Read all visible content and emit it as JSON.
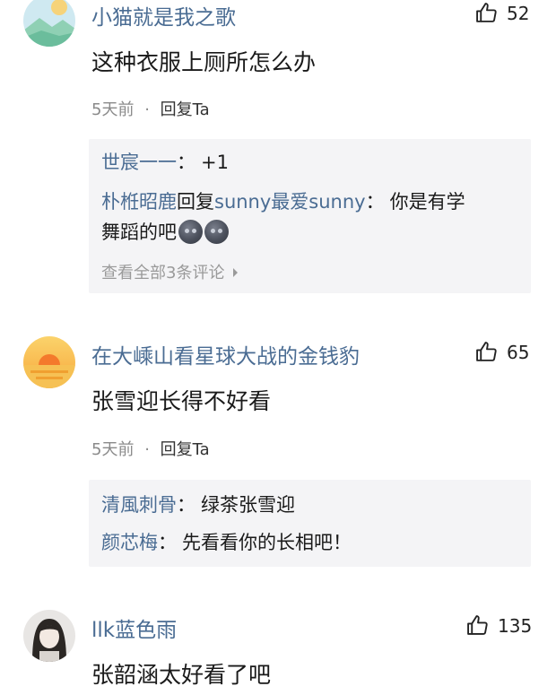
{
  "comments": [
    {
      "username": "小猫就是我之歌",
      "likes": "52",
      "text": "这种衣服上厕所怎么办",
      "time": "5天前",
      "dot": "·",
      "reply_label": "回复Ta",
      "replies": [
        {
          "name": "世宸一一",
          "sep": "：",
          "content": "+1"
        },
        {
          "name": "朴栣昭鹿",
          "middle": "回复",
          "target": "sunny最爱sunny",
          "sep": "：",
          "content": "你是有学",
          "content2": "舞蹈的吧"
        }
      ],
      "view_all": "查看全部3条评论"
    },
    {
      "username": "在大嵊山看星球大战的金钱豹",
      "likes": "65",
      "text": "张雪迎长得不好看",
      "time": "5天前",
      "dot": "·",
      "reply_label": "回复Ta",
      "replies": [
        {
          "name": "清風刺骨",
          "sep": "：",
          "content": "绿茶张雪迎"
        },
        {
          "name": "颜芯梅",
          "sep": "：",
          "content": "先看看你的长相吧！"
        }
      ]
    },
    {
      "username": "llk蓝色雨",
      "likes": "135",
      "text": "张韶涵太好看了吧"
    }
  ],
  "colors": {
    "username": "#4a6c93",
    "reply_bg": "#f4f4f6",
    "meta": "#8a8a8a"
  },
  "icons": [
    "thumbs-up-icon",
    "chevron-right-icon",
    "dark-moon-face-emoji"
  ]
}
